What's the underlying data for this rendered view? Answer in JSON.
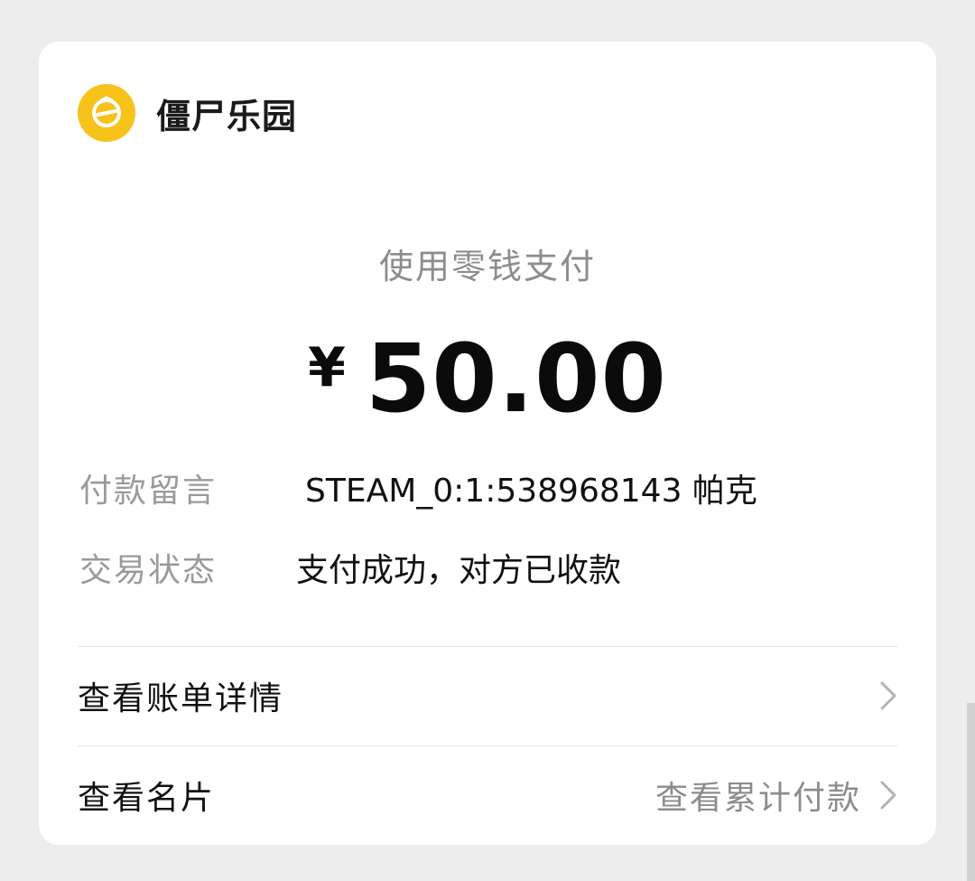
{
  "merchant": {
    "name": "僵尸乐园",
    "logo_icon": "merchant-logo-icon",
    "logo_color": "#f7c21a"
  },
  "payment": {
    "method": "使用零钱支付",
    "currency_symbol": "¥",
    "amount": "50.00"
  },
  "details": [
    {
      "label": "付款留言",
      "value": "STEAM_0:1:538968143 帕克"
    },
    {
      "label": "交易状态",
      "value": "支付成功，对方已收款"
    }
  ],
  "links": {
    "bill_details": "查看账单详情",
    "business_card": "查看名片",
    "cumulative_payments": "查看累计付款",
    "chevron_icon": "chevron-right-icon"
  }
}
